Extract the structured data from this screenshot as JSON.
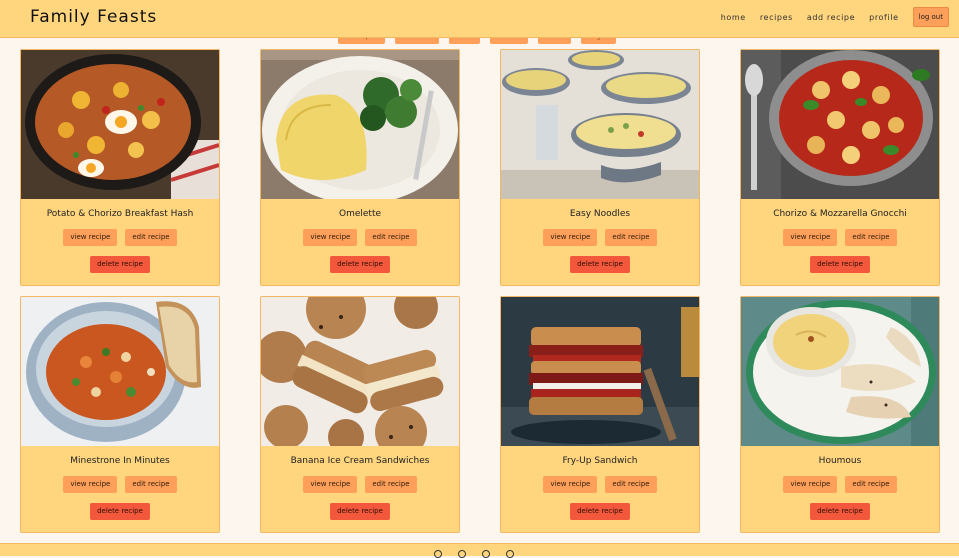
{
  "brand": "Family Feasts",
  "nav": {
    "home": "home",
    "recipes": "recipes",
    "add_recipe": "add recipe",
    "profile": "profile",
    "logout": "log out"
  },
  "filters": [
    "all recipes",
    "breakfast",
    "main",
    "dessert",
    "snack",
    "vegan"
  ],
  "card_actions": {
    "view": "view recipe",
    "edit": "edit recipe",
    "delete": "delete recipe"
  },
  "recipes": [
    {
      "title": "Potato & Chorizo Breakfast Hash",
      "image": "potato-chorizo-hash-photo"
    },
    {
      "title": "Omelette",
      "image": "omelette-photo"
    },
    {
      "title": "Easy Noodles",
      "image": "noodles-photo"
    },
    {
      "title": "Chorizo & Mozzarella Gnocchi",
      "image": "gnocchi-photo"
    },
    {
      "title": "Minestrone In Minutes",
      "image": "minestrone-photo"
    },
    {
      "title": "Banana Ice Cream Sandwiches",
      "image": "ice-cream-sandwich-photo"
    },
    {
      "title": "Fry-Up Sandwich",
      "image": "fry-up-sandwich-photo"
    },
    {
      "title": "Houmous",
      "image": "houmous-photo"
    }
  ],
  "footer": {
    "social_icons": [
      "instagram-icon",
      "facebook-icon",
      "twitter-icon",
      "pinterest-icon"
    ]
  },
  "colors": {
    "header": "#ffd57e",
    "card": "#ffd57e",
    "button": "#ffa05a",
    "delete": "#f4583c",
    "background": "#fdf6ee"
  }
}
